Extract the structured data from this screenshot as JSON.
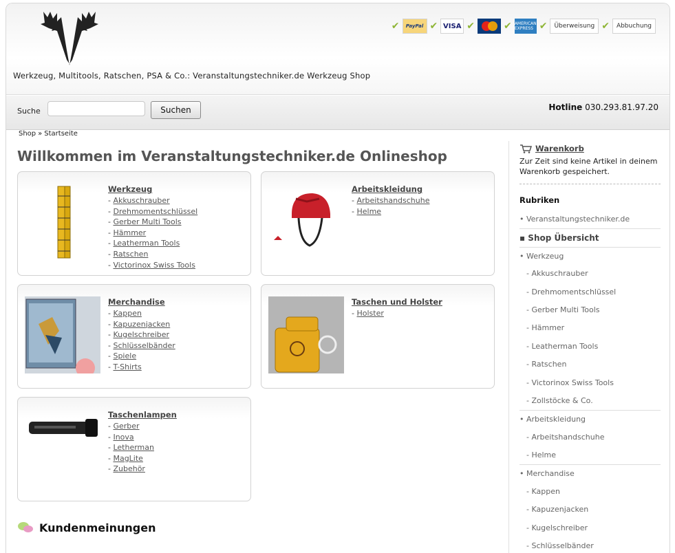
{
  "header": {
    "tagline": "Werkzeug, Multitools, Ratschen, PSA & Co.: Veranstaltungstechniker.de Werkzeug Shop",
    "payments": [
      "PayPal",
      "VISA",
      "MasterCard",
      "AMERICAN EXPRESS",
      "Überweisung",
      "Abbuchung"
    ]
  },
  "search": {
    "label": "Suche",
    "placeholder": "",
    "button_label": "Suchen"
  },
  "hotline": {
    "label": "Hotline",
    "number": "030.293.81.97.20"
  },
  "breadcrumb": {
    "items": [
      "Shop",
      "Startseite"
    ],
    "separator": "»"
  },
  "main": {
    "title": "Willkommen im Veranstaltungstechniker.de Onlineshop",
    "categories": [
      {
        "title": "Werkzeug",
        "items": [
          "Akkuschrauber",
          "Drehmomentschlüssel",
          "Gerber Multi Tools",
          "Hämmer",
          "Leatherman Tools",
          "Ratschen",
          "Victorinox Swiss Tools"
        ]
      },
      {
        "title": "Arbeitskleidung",
        "items": [
          "Arbeitshandschuhe",
          "Helme"
        ]
      },
      {
        "title": "Merchandise",
        "items": [
          "Kappen",
          "Kapuzenjacken",
          "Kugelschreiber",
          "Schlüsselbänder",
          "Spiele",
          "T-Shirts"
        ]
      },
      {
        "title": "Taschen und Holster",
        "items": [
          "Holster"
        ]
      },
      {
        "title": "Taschenlampen",
        "items": [
          "Gerber",
          "Inova",
          "Letherman",
          "MagLite",
          "Zubehör"
        ]
      }
    ],
    "reviews_title": "Kundenmeinungen"
  },
  "sidebar": {
    "cart_title": "Warenkorb",
    "cart_text": "Zur Zeit sind keine Artikel in deinem Warenkorb gespeichert.",
    "rubriken_title": "Rubriken",
    "categories": [
      {
        "label": "• Veranstaltungstechniker.de",
        "level": 0
      },
      {
        "label": "▪ Shop Übersicht",
        "level": 0,
        "bold": true
      },
      {
        "label": "• Werkzeug",
        "level": 0
      },
      {
        "label": "- Akkuschrauber",
        "level": 1
      },
      {
        "label": "- Drehmomentschlüssel",
        "level": 1
      },
      {
        "label": "- Gerber Multi Tools",
        "level": 1
      },
      {
        "label": "- Hämmer",
        "level": 1
      },
      {
        "label": "- Leatherman Tools",
        "level": 1
      },
      {
        "label": "- Ratschen",
        "level": 1
      },
      {
        "label": "- Victorinox Swiss Tools",
        "level": 1
      },
      {
        "label": "- Zollstöcke & Co.",
        "level": 1
      },
      {
        "label": "• Arbeitskleidung",
        "level": 0
      },
      {
        "label": "- Arbeitshandschuhe",
        "level": 1
      },
      {
        "label": "- Helme",
        "level": 1
      },
      {
        "label": "• Merchandise",
        "level": 0
      },
      {
        "label": "- Kappen",
        "level": 1
      },
      {
        "label": "- Kapuzenjacken",
        "level": 1
      },
      {
        "label": "- Kugelschreiber",
        "level": 1
      },
      {
        "label": "- Schlüsselbänder",
        "level": 1
      }
    ]
  },
  "colors": {
    "accent_check": "#8fb536",
    "title_gray": "#555555"
  }
}
